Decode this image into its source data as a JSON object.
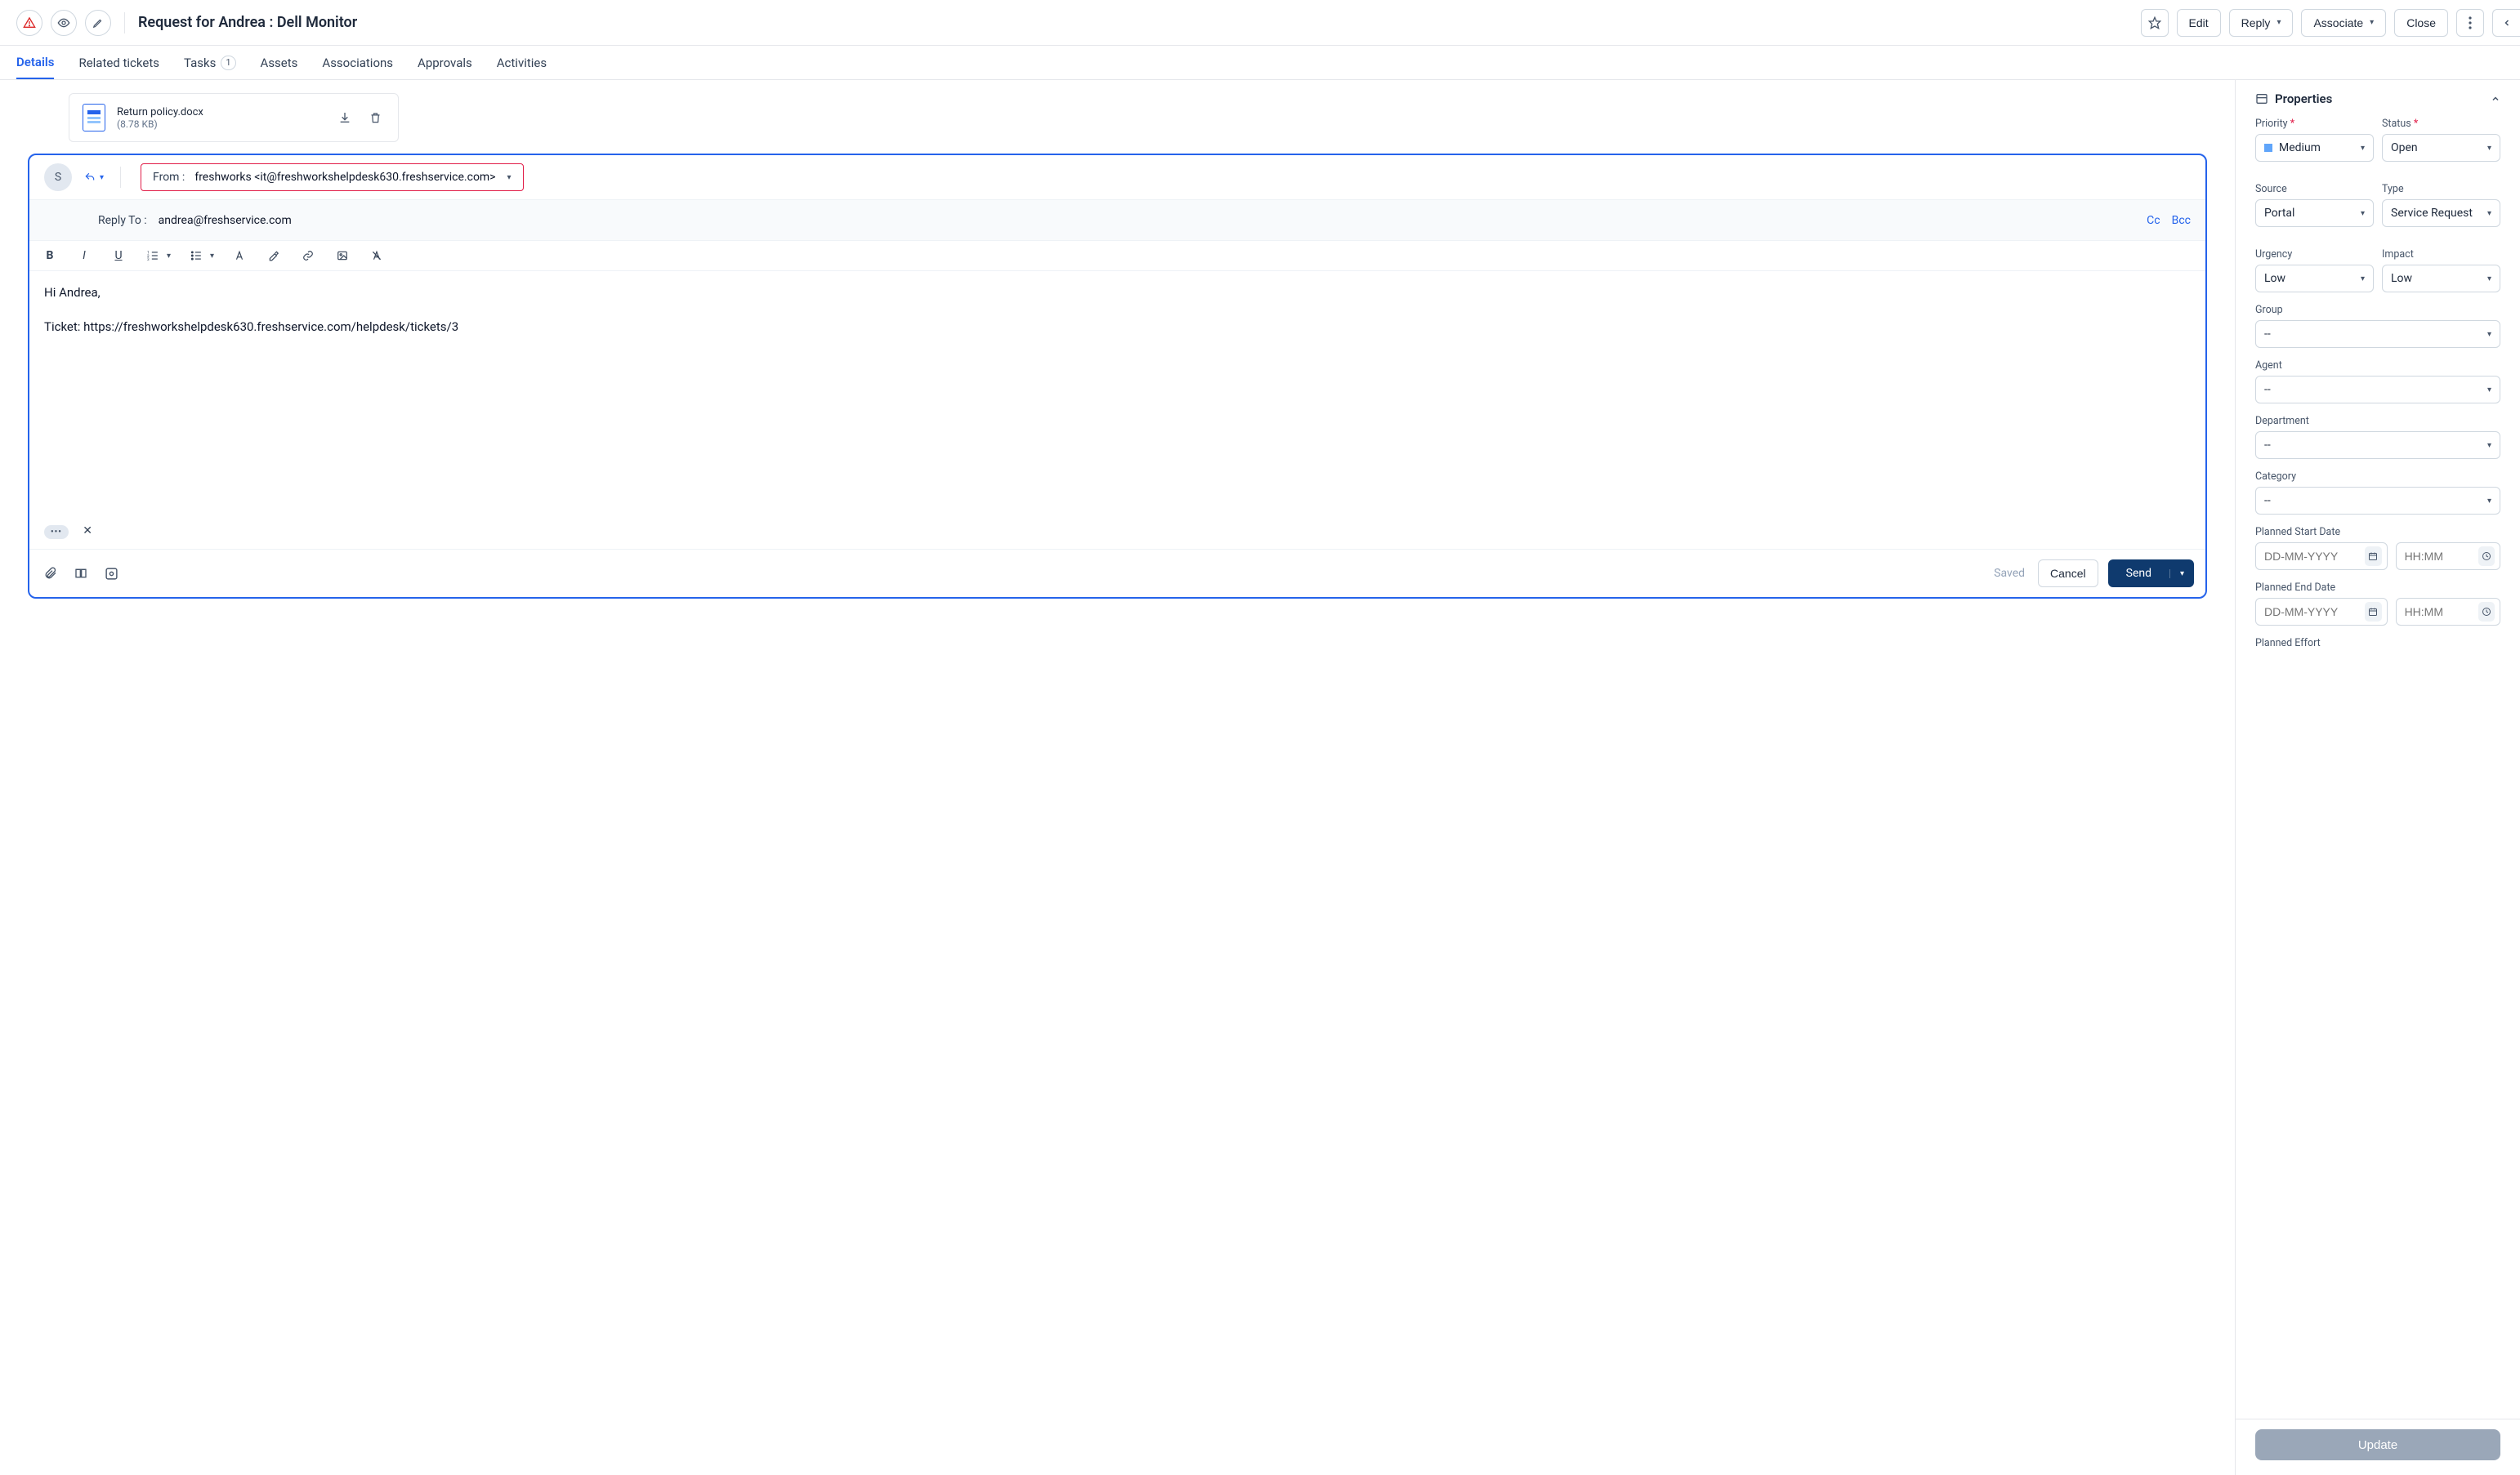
{
  "header": {
    "title": "Request for Andrea : Dell Monitor",
    "edit": "Edit",
    "reply": "Reply",
    "associate": "Associate",
    "close": "Close"
  },
  "tabs": {
    "details": "Details",
    "related": "Related tickets",
    "tasks": "Tasks",
    "tasks_count": "1",
    "assets": "Assets",
    "associations": "Associations",
    "approvals": "Approvals",
    "activities": "Activities"
  },
  "attachment": {
    "name": "Return policy.docx",
    "size": "(8.78 KB)"
  },
  "composer": {
    "avatar_initial": "S",
    "from_label": "From :",
    "from_value": "freshworks <it@freshworkshelpdesk630.freshservice.com>",
    "reply_to_label": "Reply To :",
    "reply_to_value": "andrea@freshservice.com",
    "cc": "Cc",
    "bcc": "Bcc",
    "body_line1": "Hi Andrea,",
    "body_line2": "Ticket: https://freshworkshelpdesk630.freshservice.com/helpdesk/tickets/3",
    "trimmed": "•••",
    "saved": "Saved",
    "cancel": "Cancel",
    "send": "Send"
  },
  "properties": {
    "heading": "Properties",
    "priority_label": "Priority",
    "priority_value": "Medium",
    "status_label": "Status",
    "status_value": "Open",
    "source_label": "Source",
    "source_value": "Portal",
    "type_label": "Type",
    "type_value": "Service Request",
    "urgency_label": "Urgency",
    "urgency_value": "Low",
    "impact_label": "Impact",
    "impact_value": "Low",
    "group_label": "Group",
    "group_value": "--",
    "agent_label": "Agent",
    "agent_value": "--",
    "department_label": "Department",
    "department_value": "--",
    "category_label": "Category",
    "category_value": "--",
    "planned_start_label": "Planned Start Date",
    "planned_end_label": "Planned End Date",
    "planned_effort_label": "Planned Effort",
    "date_placeholder": "DD-MM-YYYY",
    "time_placeholder": "HH:MM",
    "update": "Update"
  }
}
